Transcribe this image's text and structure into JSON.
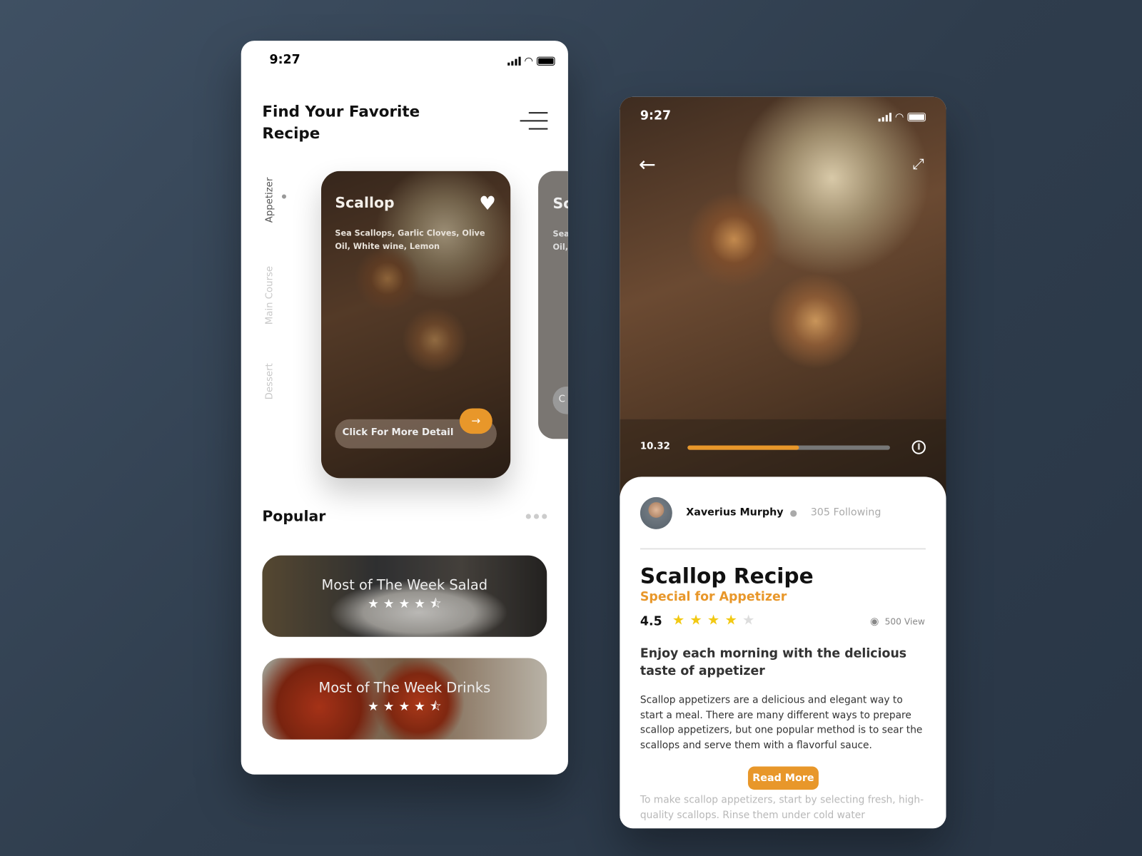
{
  "left": {
    "status_time": "9:27",
    "title_line1": "Find Your Favorite",
    "title_line2": "Recipe",
    "categories": [
      {
        "label": "Appetizer",
        "active": true
      },
      {
        "label": "Main Course",
        "active": false
      },
      {
        "label": "Dessert",
        "active": false
      }
    ],
    "card": {
      "title": "Scallop",
      "ingredients": "Sea Scallops, Garlic Cloves, Olive Oil, White wine, Lemon",
      "cta": "Click For More Detail",
      "favorite": true
    },
    "next_card": {
      "title": "Sc",
      "ingredients_line1": "Sea",
      "ingredients_line2": "Oil,",
      "cta": "C"
    },
    "popular_title": "Popular",
    "popular": [
      {
        "title": "Most of The Week Salad",
        "rating": 4.5
      },
      {
        "title": "Most of The Week Drinks",
        "rating": 4.5
      }
    ]
  },
  "right": {
    "status_time": "9:27",
    "video_time": "10.32",
    "progress": 0.55,
    "author": "Xaverius Murphy",
    "following": "305 Following",
    "title": "Scallop Recipe",
    "subtitle": "Special for Appetizer",
    "rating": "4.5",
    "rating_value": 4,
    "views": "500 View",
    "headline": "Enjoy each morning with the delicious taste of appetizer",
    "body": "Scallop appetizers are a delicious and elegant way to start a meal. There are many different ways to prepare scallop appetizers, but one popular method is to sear the scallops and serve them with a flavorful sauce.",
    "faded_text": "To make scallop appetizers, start by selecting fresh, high-quality scallops. Rinse them under cold water",
    "read_more": "Read More"
  },
  "colors": {
    "accent": "#e8972a",
    "star": "#f2c913",
    "background": "#3a4a5c"
  }
}
